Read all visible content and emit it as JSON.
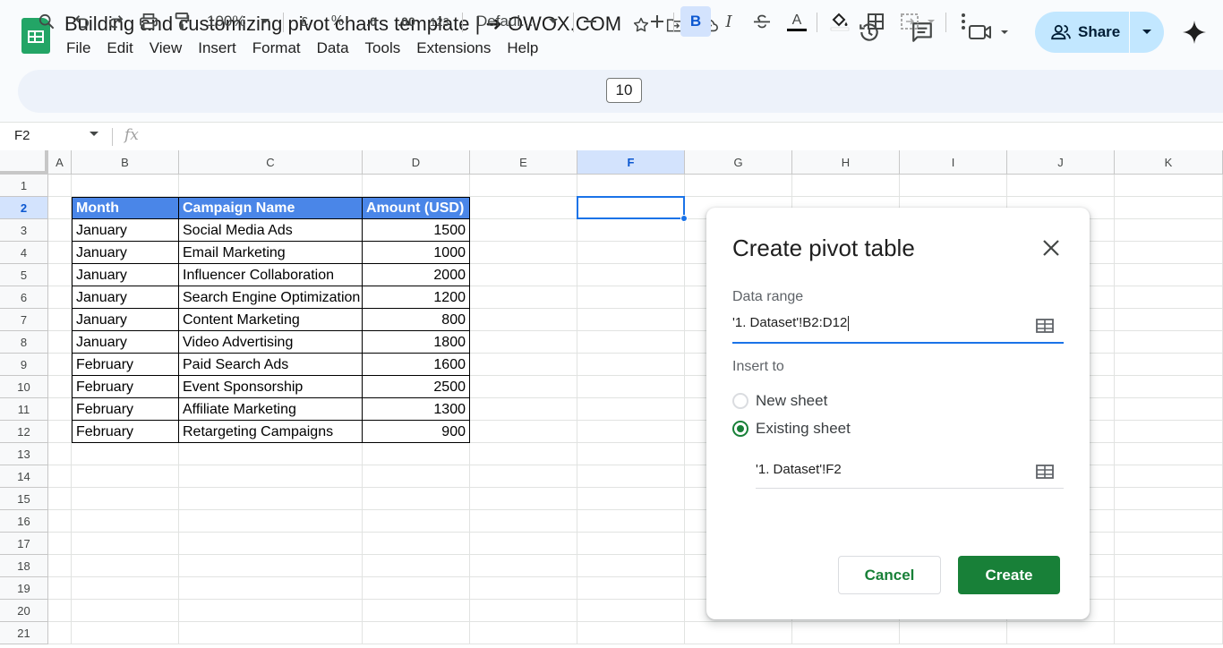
{
  "app": {
    "doc_title": "Building and customizing pivot charts template | ➜ OWOX.COM",
    "menu": [
      "File",
      "Edit",
      "View",
      "Insert",
      "Format",
      "Data",
      "Tools",
      "Extensions",
      "Help"
    ],
    "share_label": "Share"
  },
  "toolbar": {
    "zoom": "100%",
    "currency": "£",
    "percent": "%",
    "decrease_decimal": ".0",
    "increase_decimal": ".00",
    "number_format": "123",
    "font": "Defaul...",
    "font_size": "10",
    "bold": "B",
    "italic": "I",
    "text_color": "A"
  },
  "formula_bar": {
    "name_box": "F2",
    "fx": "fx"
  },
  "sheet": {
    "columns": [
      "A",
      "B",
      "C",
      "D",
      "E",
      "F",
      "G",
      "H",
      "I",
      "J",
      "K"
    ],
    "rows": [
      "1",
      "2",
      "3",
      "4",
      "5",
      "6",
      "7",
      "8",
      "9",
      "10",
      "11",
      "12",
      "13",
      "14",
      "15",
      "16",
      "17",
      "18",
      "19",
      "20",
      "21"
    ],
    "selected_column": "F",
    "selected_row": "2",
    "table_header": [
      "Month",
      "Campaign Name",
      "Amount (USD)"
    ],
    "table_rows": [
      [
        "January",
        "Social Media Ads",
        "1500"
      ],
      [
        "January",
        "Email Marketing",
        "1000"
      ],
      [
        "January",
        "Influencer Collaboration",
        "2000"
      ],
      [
        "January",
        "Search Engine Optimization",
        "1200"
      ],
      [
        "January",
        "Content Marketing",
        "800"
      ],
      [
        "January",
        "Video Advertising",
        "1800"
      ],
      [
        "February",
        "Paid Search Ads",
        "1600"
      ],
      [
        "February",
        "Event Sponsorship",
        "2500"
      ],
      [
        "February",
        "Affiliate Marketing",
        "1300"
      ],
      [
        "February",
        "Retargeting Campaigns",
        "900"
      ]
    ],
    "header_color": "#4a86e8"
  },
  "dialog": {
    "title": "Create pivot table",
    "data_range_label": "Data range",
    "data_range_value": "'1. Dataset'!B2:D12",
    "insert_to_label": "Insert to",
    "option_new_sheet": "New sheet",
    "option_existing_sheet": "Existing sheet",
    "selected_option": "Existing sheet",
    "destination_value": "'1. Dataset'!F2",
    "cancel_label": "Cancel",
    "create_label": "Create",
    "accent_color": "#188038"
  }
}
